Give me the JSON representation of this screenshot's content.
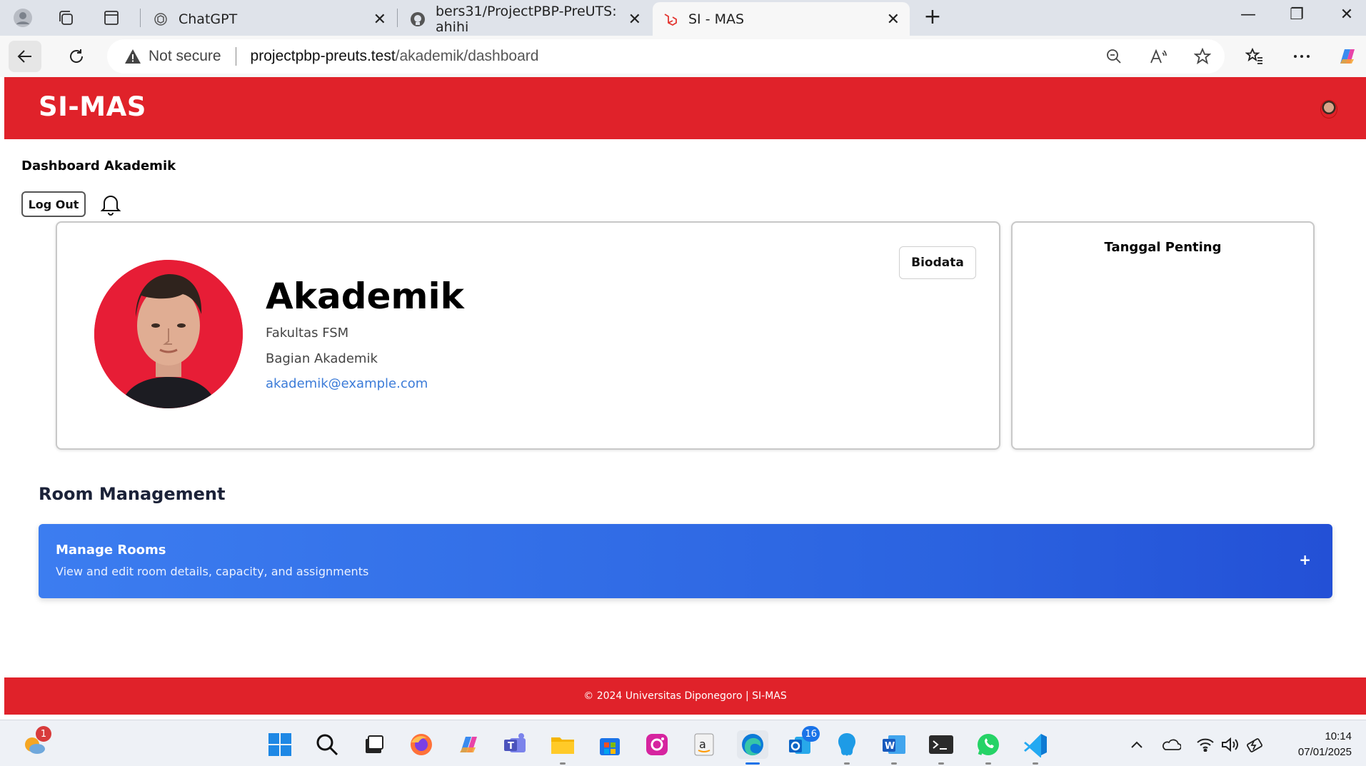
{
  "browser": {
    "tabs": [
      {
        "title": "ChatGPT",
        "active": false
      },
      {
        "title": "bers31/ProjectPBP-PreUTS: ahihi",
        "active": false
      },
      {
        "title": "SI - MAS",
        "active": true
      }
    ],
    "security_label": "Not secure",
    "url_host": "projectpbp-preuts.test",
    "url_path": "/akademik/dashboard"
  },
  "app": {
    "brand": "SI-MAS",
    "page_title": "Dashboard Akademik",
    "logout_label": "Log Out"
  },
  "profile": {
    "name": "Akademik",
    "faculty": "Fakultas FSM",
    "department": "Bagian Akademik",
    "email": "akademik@example.com",
    "biodata_label": "Biodata"
  },
  "dates": {
    "title": "Tanggal Penting"
  },
  "rooms": {
    "section_title": "Room Management",
    "card_title": "Manage Rooms",
    "card_subtitle": "View and edit room details, capacity, and assignments",
    "action_symbol": "+"
  },
  "footer": {
    "text": "© 2024 Universitas Diponegoro | SI-MAS"
  },
  "taskbar": {
    "weather_badge": "1",
    "outlook_badge": "16",
    "time": "10:14",
    "date": "07/01/2025"
  },
  "colors": {
    "brand_red": "#e0222a",
    "accent_blue": "#2b63e0",
    "link_blue": "#3b7bd8"
  }
}
